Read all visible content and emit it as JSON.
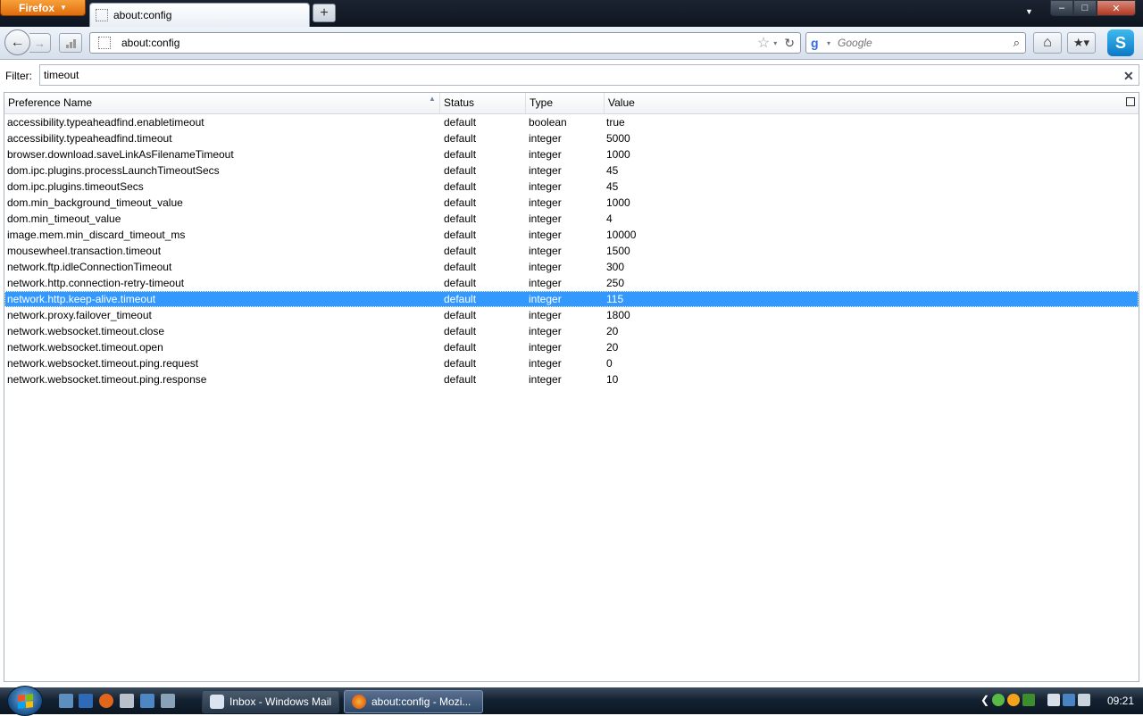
{
  "window": {
    "menu_button_label": "Firefox",
    "tab_title": "about:config",
    "new_tab_label": "+",
    "minimize_label": "–",
    "maximize_label": "□",
    "close_label": "✕"
  },
  "toolbar": {
    "back_label": "←",
    "forward_label": "→",
    "url": "about:config",
    "bookmark_star": "☆",
    "dropdown": "▾",
    "reload": "↻",
    "search_engine_letter": "g",
    "search_placeholder": "Google",
    "search_icon": "⌕",
    "home_label": "⌂",
    "bookmarks_label": "★▾",
    "skype_label": "S"
  },
  "filter": {
    "label": "Filter:",
    "value": "timeout",
    "clear_label": "✕"
  },
  "table": {
    "columns": [
      "Preference Name",
      "Status",
      "Type",
      "Value"
    ],
    "sort_indicator": "▲",
    "selected_index": 11,
    "rows": [
      {
        "name": "accessibility.typeaheadfind.enabletimeout",
        "status": "default",
        "type": "boolean",
        "value": "true"
      },
      {
        "name": "accessibility.typeaheadfind.timeout",
        "status": "default",
        "type": "integer",
        "value": "5000"
      },
      {
        "name": "browser.download.saveLinkAsFilenameTimeout",
        "status": "default",
        "type": "integer",
        "value": "1000"
      },
      {
        "name": "dom.ipc.plugins.processLaunchTimeoutSecs",
        "status": "default",
        "type": "integer",
        "value": "45"
      },
      {
        "name": "dom.ipc.plugins.timeoutSecs",
        "status": "default",
        "type": "integer",
        "value": "45"
      },
      {
        "name": "dom.min_background_timeout_value",
        "status": "default",
        "type": "integer",
        "value": "1000"
      },
      {
        "name": "dom.min_timeout_value",
        "status": "default",
        "type": "integer",
        "value": "4"
      },
      {
        "name": "image.mem.min_discard_timeout_ms",
        "status": "default",
        "type": "integer",
        "value": "10000"
      },
      {
        "name": "mousewheel.transaction.timeout",
        "status": "default",
        "type": "integer",
        "value": "1500"
      },
      {
        "name": "network.ftp.idleConnectionTimeout",
        "status": "default",
        "type": "integer",
        "value": "300"
      },
      {
        "name": "network.http.connection-retry-timeout",
        "status": "default",
        "type": "integer",
        "value": "250"
      },
      {
        "name": "network.http.keep-alive.timeout",
        "status": "default",
        "type": "integer",
        "value": "115"
      },
      {
        "name": "network.proxy.failover_timeout",
        "status": "default",
        "type": "integer",
        "value": "1800"
      },
      {
        "name": "network.websocket.timeout.close",
        "status": "default",
        "type": "integer",
        "value": "20"
      },
      {
        "name": "network.websocket.timeout.open",
        "status": "default",
        "type": "integer",
        "value": "20"
      },
      {
        "name": "network.websocket.timeout.ping.request",
        "status": "default",
        "type": "integer",
        "value": "0"
      },
      {
        "name": "network.websocket.timeout.ping.response",
        "status": "default",
        "type": "integer",
        "value": "10"
      }
    ]
  },
  "taskbar": {
    "tasks": [
      {
        "label": "Inbox - Windows Mail",
        "icon": "mail-icon"
      },
      {
        "label": "about:config - Mozi...",
        "icon": "firefox-icon"
      }
    ],
    "tray_expand": "❮",
    "clock": "09:21"
  },
  "colors": {
    "selection": "#3399ff",
    "firefox_button": "#e8791c",
    "taskbar": "#152232"
  }
}
